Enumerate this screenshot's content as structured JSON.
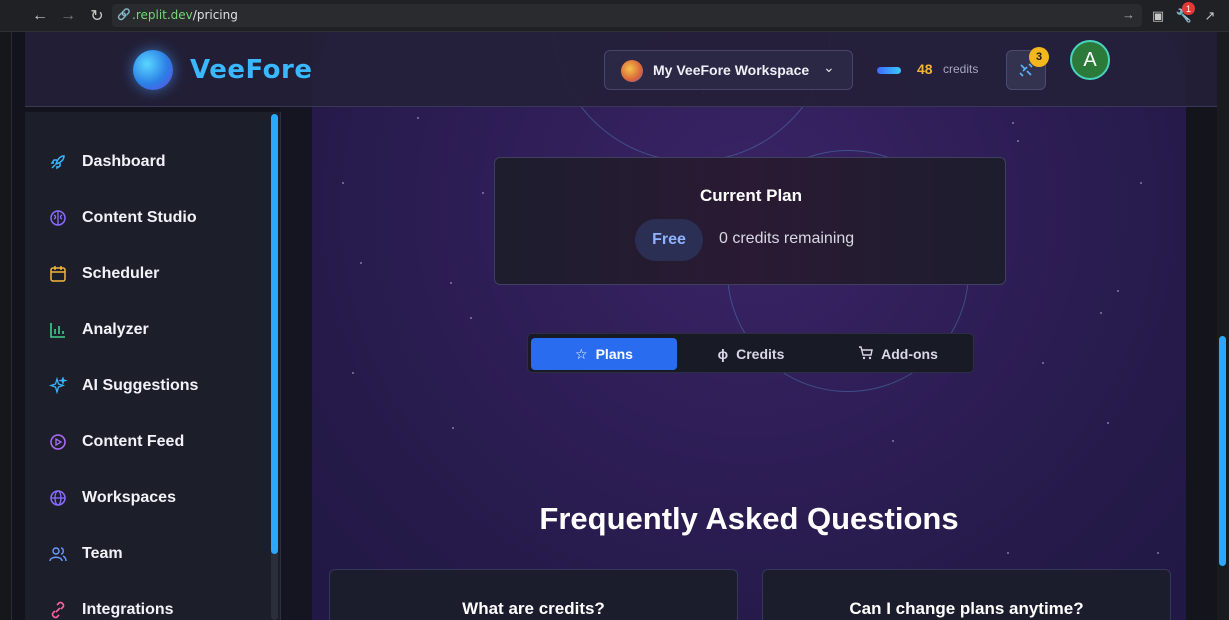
{
  "browser": {
    "url_host": ".replit.dev",
    "url_path": "/pricing",
    "extension_badge": "1"
  },
  "header": {
    "brand": "VeeFore",
    "workspace": "My VeeFore Workspace",
    "credits_count": "48",
    "credits_label": "credits",
    "notification_count": "3",
    "user_initial": "A"
  },
  "sidebar": {
    "items": [
      {
        "label": "Dashboard",
        "icon": "rocket-icon",
        "color": "#38b6ff"
      },
      {
        "label": "Content Studio",
        "icon": "brain-icon",
        "color": "#8b6cff"
      },
      {
        "label": "Scheduler",
        "icon": "calendar-icon",
        "color": "#f5b53a"
      },
      {
        "label": "Analyzer",
        "icon": "bar-chart-icon",
        "color": "#3fd28a"
      },
      {
        "label": "AI Suggestions",
        "icon": "sparkles-icon",
        "color": "#38b6ff"
      },
      {
        "label": "Content Feed",
        "icon": "play-circle-icon",
        "color": "#b06cff"
      },
      {
        "label": "Workspaces",
        "icon": "globe-icon",
        "color": "#8b6cff"
      },
      {
        "label": "Team",
        "icon": "users-icon",
        "color": "#6c9cff"
      },
      {
        "label": "Integrations",
        "icon": "link-icon",
        "color": "#ff5fa0"
      }
    ]
  },
  "current_plan": {
    "title": "Current Plan",
    "plan_name": "Free",
    "credits_remaining": "0 credits remaining"
  },
  "tabs": [
    {
      "label": "Plans",
      "icon": "star-icon",
      "active": true
    },
    {
      "label": "Credits",
      "icon": "lightning-icon",
      "active": false
    },
    {
      "label": "Add-ons",
      "icon": "cart-icon",
      "active": false
    }
  ],
  "faq": {
    "title": "Frequently Asked Questions",
    "questions": [
      "What are credits?",
      "Can I change plans anytime?"
    ]
  },
  "colors": {
    "accent": "#2a6cf0",
    "brand": "#39b8ff",
    "credits": "#f2b535"
  }
}
